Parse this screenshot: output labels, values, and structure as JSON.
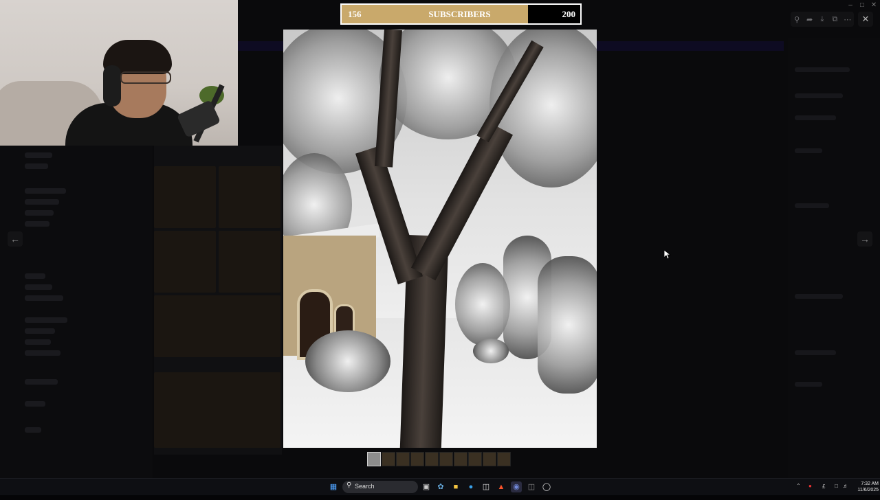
{
  "subscriber_bar": {
    "current": "156",
    "label": "SUBSCRIBERS",
    "goal": "200",
    "progress_fraction": 0.78,
    "fill_color": "#c9a96b"
  },
  "viewer": {
    "prev_icon": "arrow-left-icon",
    "next_icon": "arrow-right-icon",
    "toolbar_icons": [
      "zoom-icon",
      "share-icon",
      "download-icon",
      "open-external-icon",
      "more-icon"
    ],
    "close_icon": "close-icon",
    "thumbnail_count": 10,
    "active_thumbnail": 0
  },
  "taskbar": {
    "search_placeholder": "Search",
    "time": "7:32 AM",
    "date": "11/6/2025",
    "icons": [
      "windows-start-icon",
      "task-view-icon",
      "copilot-icon",
      "file-explorer-icon",
      "edge-icon",
      "store-icon",
      "brave-icon",
      "discord-icon",
      "xbox-icon",
      "chrome-icon"
    ]
  }
}
